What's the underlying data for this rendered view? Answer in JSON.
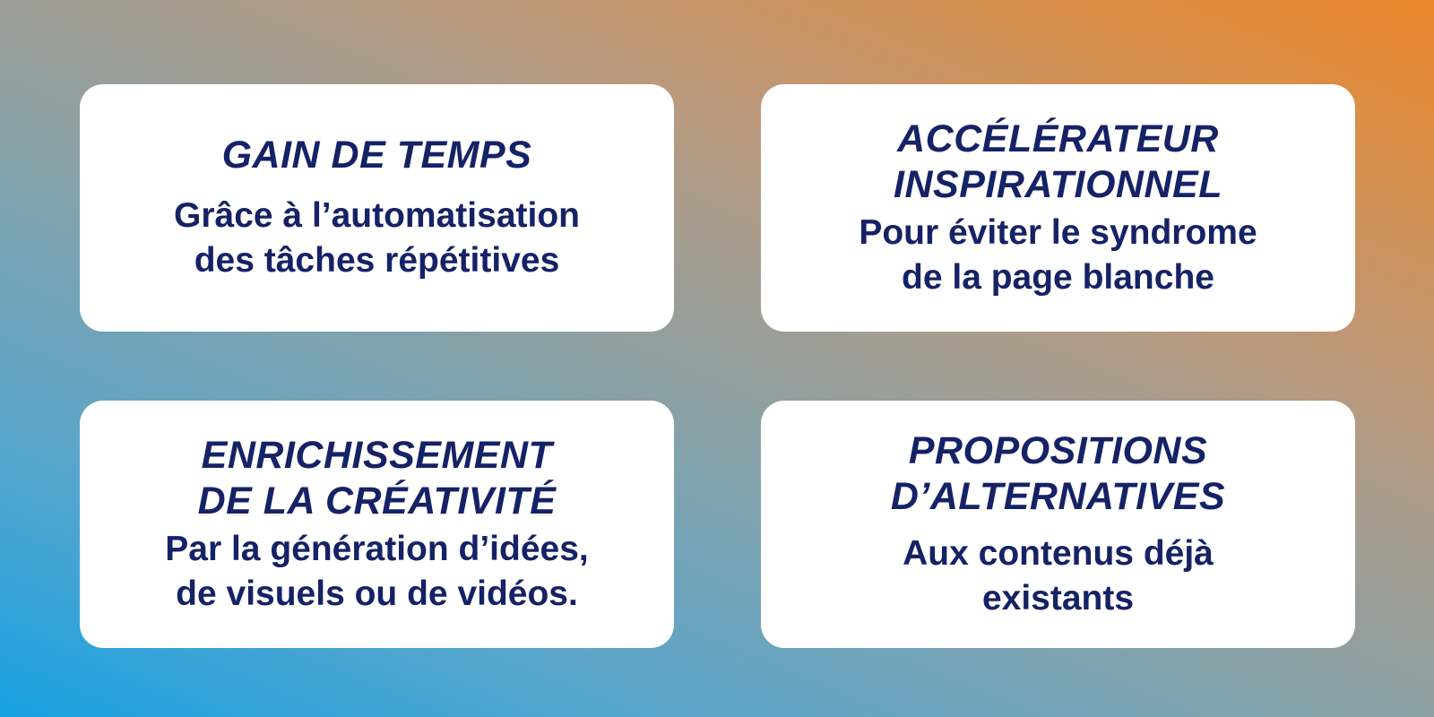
{
  "cards": [
    {
      "title_lines": [
        "GAIN DE TEMPS"
      ],
      "text_lines": [
        "Grâce à l’automatisation",
        "des tâches répétitives"
      ]
    },
    {
      "title_lines": [
        "ACCÉLÉRATEUR",
        "INSPIRATIONNEL"
      ],
      "text_lines": [
        "Pour éviter le syndrome",
        "de la page blanche"
      ]
    },
    {
      "title_lines": [
        "ENRICHISSEMENT",
        "DE LA CRÉATIVITÉ"
      ],
      "text_lines": [
        "Par la génération d’idées,",
        "de visuels ou de vidéos."
      ]
    },
    {
      "title_lines": [
        "PROPOSITIONS",
        "D’ALTERNATIVES"
      ],
      "text_lines": [
        "Aux contenus déjà",
        "existants"
      ]
    }
  ],
  "colors": {
    "text": "#152266",
    "card_background": "#ffffff",
    "gradient_start": "#18a1e1",
    "gradient_end": "#ea8529"
  }
}
